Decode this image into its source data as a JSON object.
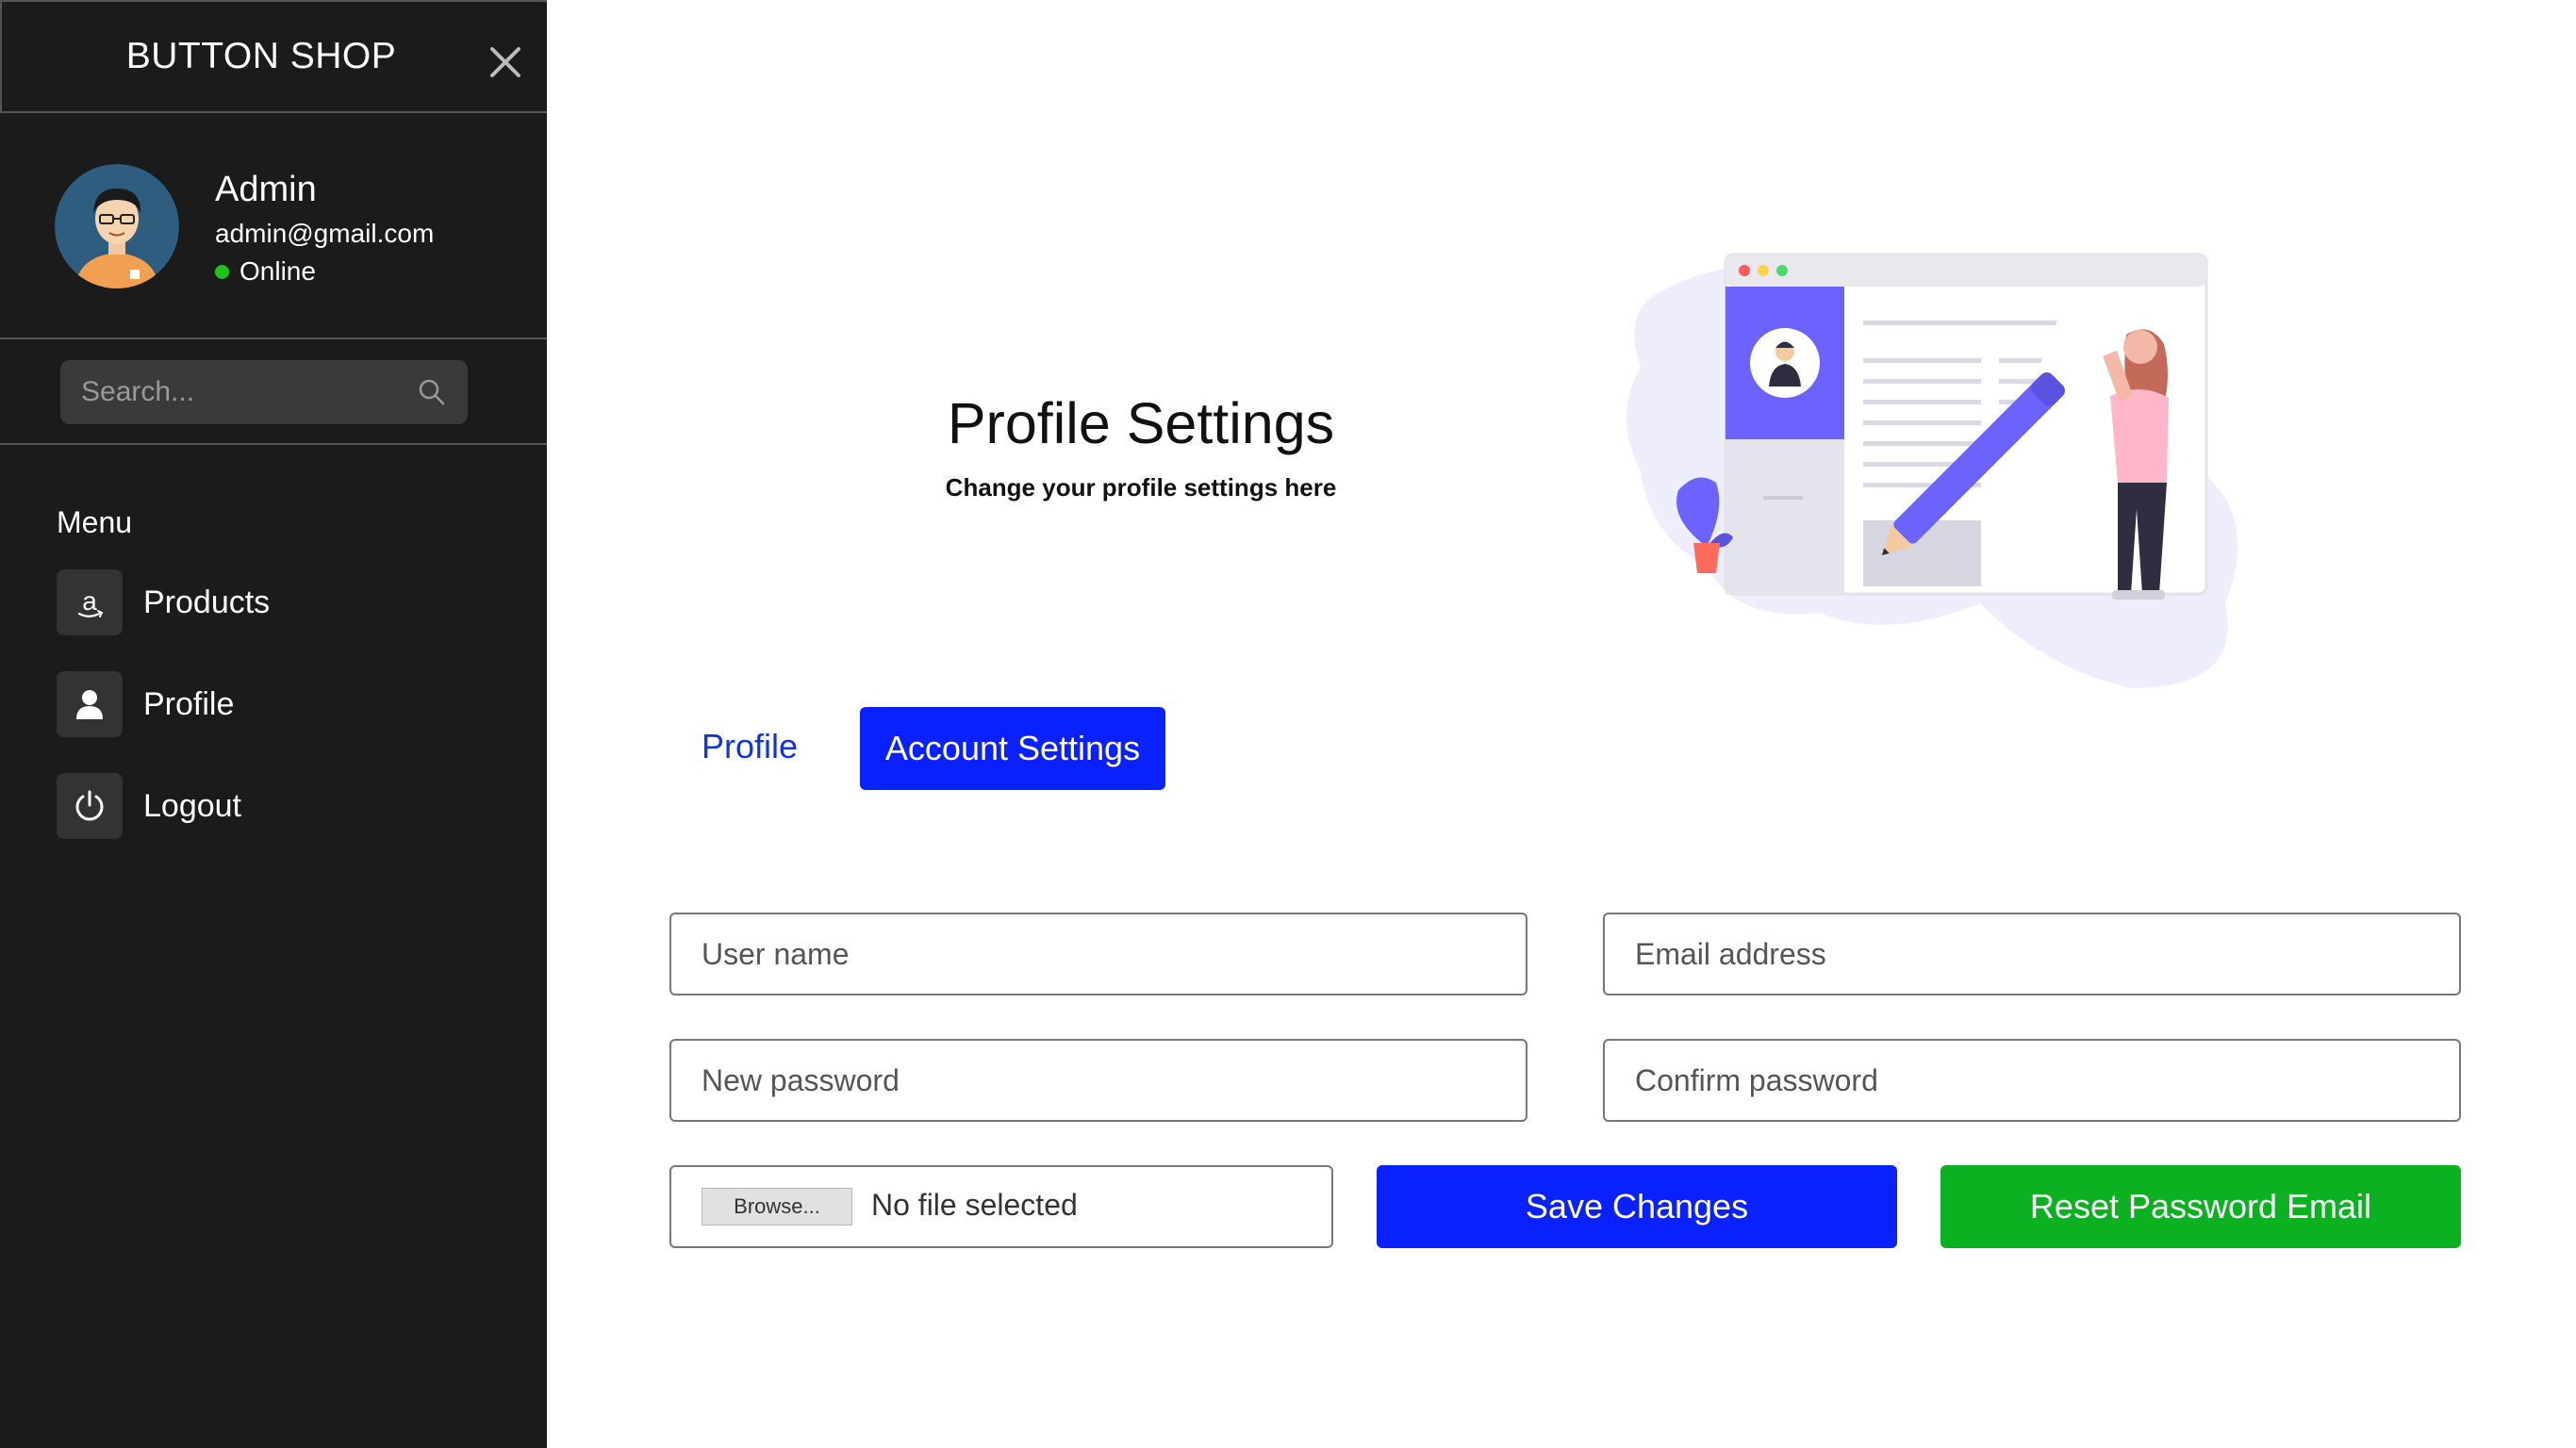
{
  "sidebar": {
    "brand": "BUTTON SHOP",
    "user": {
      "name": "Admin",
      "email": "admin@gmail.com",
      "status": "Online",
      "status_color": "#1ec31e"
    },
    "search": {
      "placeholder": "Search..."
    },
    "menu_label": "Menu",
    "items": [
      {
        "label": "Products",
        "icon": "amazon-icon"
      },
      {
        "label": "Profile",
        "icon": "user-icon"
      },
      {
        "label": "Logout",
        "icon": "power-icon"
      }
    ],
    "background": "#1b1b1b"
  },
  "header": {
    "title": "Profile Settings",
    "subtitle": "Change your profile settings here"
  },
  "tabs": [
    {
      "label": "Profile",
      "active": false
    },
    {
      "label": "Account Settings",
      "active": true
    }
  ],
  "form": {
    "username": {
      "placeholder": "User name",
      "value": ""
    },
    "email": {
      "placeholder": "Email address",
      "value": ""
    },
    "new_password": {
      "placeholder": "New password",
      "value": ""
    },
    "confirm_password": {
      "placeholder": "Confirm password",
      "value": ""
    },
    "file": {
      "browse_label": "Browse...",
      "status": "No file selected"
    },
    "save_label": "Save Changes",
    "reset_label": "Reset Password Email"
  },
  "colors": {
    "primary": "#0a21ff",
    "success": "#0bb120",
    "illustration_accent": "#6c63ff"
  }
}
